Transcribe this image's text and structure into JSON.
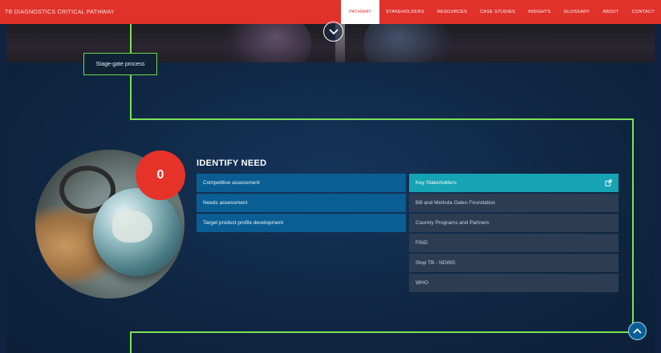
{
  "header": {
    "brand": "TB DIAGNOSTICS CRITICAL PATHWAY",
    "nav": [
      {
        "label": "PATHWAY",
        "active": true
      },
      {
        "label": "STAKEHOLDERS",
        "active": false
      },
      {
        "label": "RESOURCES",
        "active": false
      },
      {
        "label": "CASE STUDIES",
        "active": false
      },
      {
        "label": "INSIGHTS",
        "active": false
      },
      {
        "label": "GLOSSARY",
        "active": false
      },
      {
        "label": "ABOUT",
        "active": false
      },
      {
        "label": "CONTACT",
        "active": false
      }
    ]
  },
  "stage_label": "Stage-gate process",
  "stage": {
    "number": "0",
    "title": "IDENTIFY NEED",
    "tasks": [
      "Competitive assessment",
      "Needs assessment",
      "Target product profile development"
    ],
    "stakeholders_header": "Key Stakeholders",
    "stakeholders": [
      "Bill and Melinda Gates Foundation",
      "Country Programs and Partners",
      "FIND",
      "Stop TB - NDWG",
      "WHO"
    ]
  },
  "icons": {
    "scroll_down": "chevron-down-icon",
    "scroll_up": "chevron-up-icon",
    "external_link": "external-link-icon"
  },
  "colors": {
    "nav_bg": "#e0312b",
    "badge": "#e53329",
    "task_bg": "#0a5e93",
    "stakeholder_header_bg": "#16a3b3",
    "stakeholder_bg": "#2c3d53",
    "connector": "#7ce055",
    "page_bg": "#0f2340"
  }
}
